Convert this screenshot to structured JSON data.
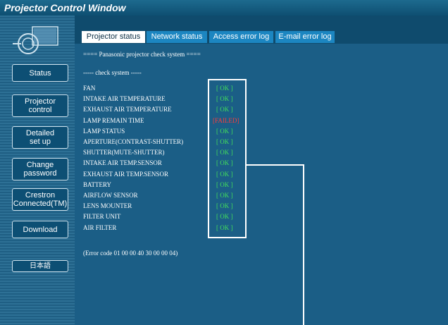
{
  "window": {
    "title": "Projector Control Window"
  },
  "sidebar": {
    "buttons": [
      {
        "label": "Status"
      },
      {
        "label": "Projector\ncontrol"
      },
      {
        "label": "Detailed\nset up"
      },
      {
        "label": "Change\npassword"
      },
      {
        "label": "Crestron\nConnected(TM)"
      },
      {
        "label": "Download"
      },
      {
        "label": "日本語"
      }
    ]
  },
  "tabs": [
    {
      "label": "Projector status"
    },
    {
      "label": "Network status"
    },
    {
      "label": "Access error log"
    },
    {
      "label": "E-mail error log"
    }
  ],
  "content": {
    "header": "==== Panasonic projector check system ====",
    "subheader": "----- check system -----",
    "items": [
      {
        "label": "FAN",
        "status": "[ OK ]"
      },
      {
        "label": "INTAKE AIR TEMPERATURE",
        "status": "[ OK ]"
      },
      {
        "label": "EXHAUST AIR TEMPERATURE",
        "status": "[ OK ]"
      },
      {
        "label": "LAMP REMAIN TIME",
        "status": "[FAILED]"
      },
      {
        "label": "LAMP STATUS",
        "status": "[ OK ]"
      },
      {
        "label": "APERTURE(CONTRAST-SHUTTER)",
        "status": "[ OK ]"
      },
      {
        "label": "SHUTTER(MUTE-SHUTTER)",
        "status": "[ OK ]"
      },
      {
        "label": "INTAKE AIR TEMP.SENSOR",
        "status": "[ OK ]"
      },
      {
        "label": "EXHAUST AIR TEMP.SENSOR",
        "status": "[ OK ]"
      },
      {
        "label": "BATTERY",
        "status": "[ OK ]"
      },
      {
        "label": "AIRFLOW SENSOR",
        "status": "[ OK ]"
      },
      {
        "label": "LENS MOUNTER",
        "status": "[ OK ]"
      },
      {
        "label": "FILTER UNIT",
        "status": "[ OK ]"
      },
      {
        "label": "AIR FILTER",
        "status": "[ OK ]"
      }
    ],
    "error_code": "(Error code 01 00 00 40 30 00 00 04)"
  },
  "colors": {
    "ok": "#42e05a",
    "failed": "#ff3b3b",
    "background": "#1b5e86",
    "sidebar": "#2d7095",
    "tab_active": "#ffffff",
    "tab_inactive": "#1c86c1"
  }
}
